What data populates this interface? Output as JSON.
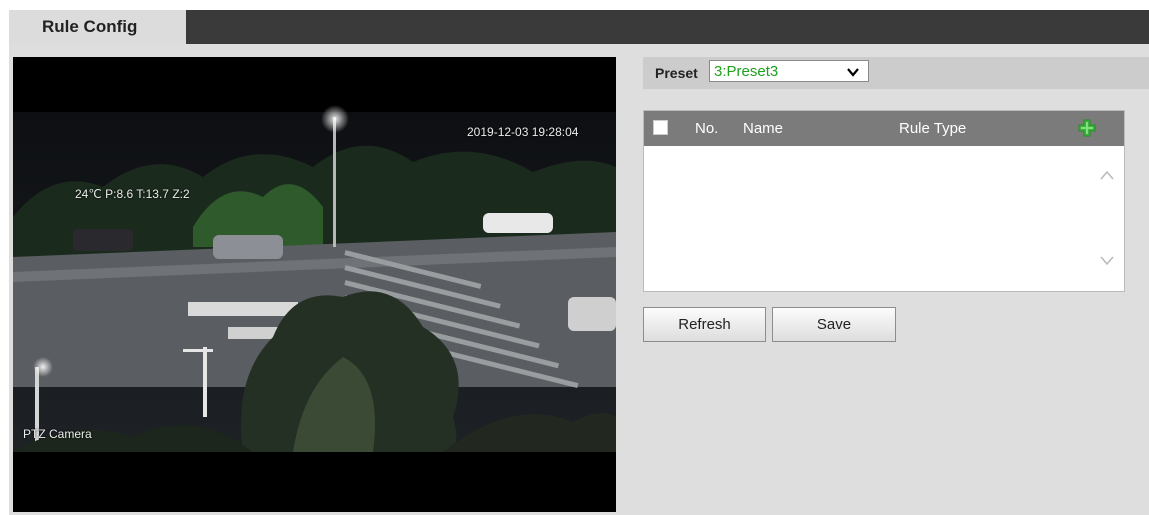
{
  "tabs": {
    "active_label": "Rule Config"
  },
  "video": {
    "timestamp": "2019-12-03 19:28:04",
    "ptz_info": "24℃ P:8.6 T:13.7 Z:2",
    "camera_name": "PTZ Camera"
  },
  "preset": {
    "label": "Preset",
    "selected": "3:Preset3"
  },
  "rule_table": {
    "columns": [
      "No.",
      "Name",
      "Rule Type"
    ],
    "rows": []
  },
  "buttons": {
    "refresh": "Refresh",
    "save": "Save"
  },
  "colors": {
    "preset_value": "#1fa01f",
    "add_icon": "#3cb43c",
    "table_header": "#7b7b7b"
  }
}
